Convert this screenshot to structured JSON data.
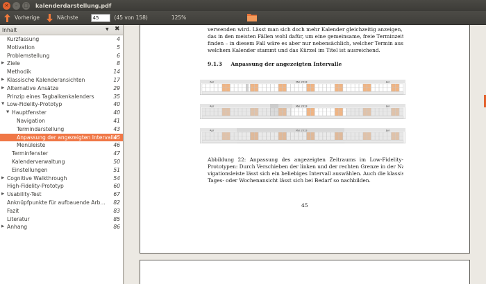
{
  "window": {
    "title": "kalenderdarstellung.pdf"
  },
  "toolbar": {
    "prev_label": "Vorherige",
    "next_label": "Nächste",
    "page_value": "45",
    "page_count": "(45 von 158)",
    "zoom": "125%"
  },
  "sidebar": {
    "header": "Inhalt",
    "items": [
      {
        "label": "Kurzfassung",
        "page": "4",
        "level": 0,
        "expander": ""
      },
      {
        "label": "Motivation",
        "page": "5",
        "level": 0,
        "expander": ""
      },
      {
        "label": "Problemstellung",
        "page": "6",
        "level": 0,
        "expander": ""
      },
      {
        "label": "Ziele",
        "page": "8",
        "level": 0,
        "expander": "right"
      },
      {
        "label": "Methodik",
        "page": "14",
        "level": 0,
        "expander": ""
      },
      {
        "label": "Klassische Kalenderansichten",
        "page": "17",
        "level": 0,
        "expander": "right"
      },
      {
        "label": "Alternative Ansätze",
        "page": "29",
        "level": 0,
        "expander": "right"
      },
      {
        "label": "Prinzip eines Tagbalkenkalenders",
        "page": "35",
        "level": 0,
        "expander": ""
      },
      {
        "label": "Low-Fidelity-Prototyp",
        "page": "40",
        "level": 0,
        "expander": "down"
      },
      {
        "label": "Hauptfenster",
        "page": "40",
        "level": 1,
        "expander": "down"
      },
      {
        "label": "Navigation",
        "page": "41",
        "level": 2,
        "expander": ""
      },
      {
        "label": "Termindarstellung",
        "page": "43",
        "level": 2,
        "expander": ""
      },
      {
        "label": "Anpassung der angezeigten Intervalle",
        "page": "45",
        "level": 2,
        "expander": "",
        "selected": true
      },
      {
        "label": "Menüleiste",
        "page": "46",
        "level": 2,
        "expander": ""
      },
      {
        "label": "Terminfenster",
        "page": "47",
        "level": 1,
        "expander": ""
      },
      {
        "label": "Kalenderverwaltung",
        "page": "50",
        "level": 1,
        "expander": ""
      },
      {
        "label": "Einstellungen",
        "page": "51",
        "level": 1,
        "expander": ""
      },
      {
        "label": "Cognitive Walkthrough",
        "page": "54",
        "level": 0,
        "expander": "right"
      },
      {
        "label": "High-Fidelity-Prototyp",
        "page": "60",
        "level": 0,
        "expander": ""
      },
      {
        "label": "Usability-Test",
        "page": "67",
        "level": 0,
        "expander": "right"
      },
      {
        "label": "Anknüpfpunkte für aufbauende Arb...",
        "page": "82",
        "level": 0,
        "expander": ""
      },
      {
        "label": "Fazit",
        "page": "83",
        "level": 0,
        "expander": ""
      },
      {
        "label": "Literatur",
        "page": "85",
        "level": 0,
        "expander": ""
      },
      {
        "label": "Anhang",
        "page": "86",
        "level": 0,
        "expander": "right"
      }
    ]
  },
  "document": {
    "intro_lines": [
      "verwenden wird. Lässt man sich doch mehr Kalender gleichzeitig anzeigen, dient",
      "das in den meisten Fällen wohl dafür, um eine gemeinsame, freie Terminzeit zu",
      "finden – in diesem Fall wäre es aber nur nebensächlich, welcher Termin aus",
      "welchem Kalender stammt und das Kürzel im Titel ist ausreichend."
    ],
    "section_number": "9.1.3",
    "section_title": "Anpassung der angezeigten Intervalle",
    "caption_lines": [
      "Abbildung 22: Anpassung des angezeigten Zeitraums im Low-Fidelity-",
      "Prototypen: Durch Verschieben der linken und der rechten Grenze in der Na-",
      "vigationsleiste lässt sich ein beliebiges Intervall auswählen. Auch die klassische",
      "Tages- oder Wochenansicht lässt sich bei Bedarf so nachbilden."
    ],
    "page_number": "45",
    "figure": {
      "month_labels": [
        "Apr",
        "Mai 2013",
        "Jun"
      ]
    }
  },
  "colors": {
    "accent": "#f07746",
    "titlebar": "#3c3b37",
    "calendar_orange": "#f0b483"
  }
}
